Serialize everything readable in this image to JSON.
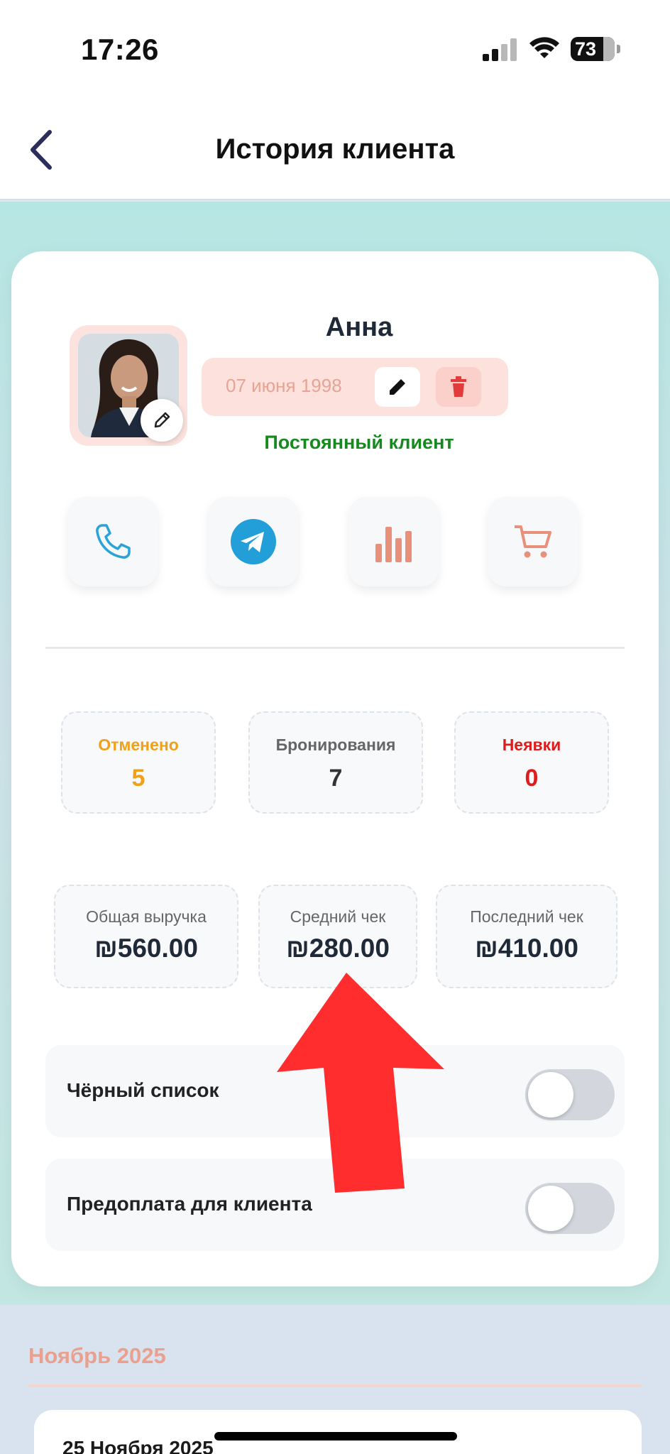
{
  "status_bar": {
    "time": "17:26",
    "battery": "73"
  },
  "header": {
    "title": "История клиента"
  },
  "client": {
    "name": "Анна",
    "birth_date": "07 июня 1998",
    "status": "Постоянный клиент"
  },
  "actions": [
    "phone-icon",
    "telegram-icon",
    "stats-icon",
    "cart-icon"
  ],
  "counts": [
    {
      "label": "Отменено",
      "value": "5",
      "color": "#f0a019"
    },
    {
      "label": "Бронирования",
      "value": "7",
      "color": "#333333"
    },
    {
      "label": "Неявки",
      "value": "0",
      "color": "#dd1c1c"
    }
  ],
  "money": [
    {
      "label": "Общая выручка",
      "value": "₪560.00"
    },
    {
      "label": "Средний чек",
      "value": "₪280.00"
    },
    {
      "label": "Последний чек",
      "value": "₪410.00"
    }
  ],
  "toggles": [
    {
      "label": "Чёрный список",
      "on": false
    },
    {
      "label": "Предоплата для клиента",
      "on": false
    }
  ],
  "history": {
    "month": "Ноябрь 2025",
    "day": "25 Ноября 2025"
  },
  "colors": {
    "accent": "#e9a08e",
    "status_green": "#168a1f",
    "telegram": "#229ed9",
    "arrow": "#ff2d2d"
  }
}
